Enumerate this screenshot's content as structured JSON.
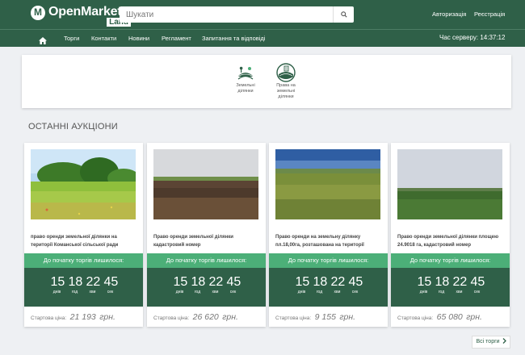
{
  "header": {
    "logo": {
      "brand": "OpenMarket",
      "sub": "Land"
    },
    "search": {
      "placeholder": "Шукати"
    },
    "login": "Авторизація",
    "register": "Реєстрація"
  },
  "nav": {
    "items": [
      "Торги",
      "Контакти",
      "Новини",
      "Регламент",
      "Запитання та відповіді"
    ],
    "server_time": "Час серверу: 14:37:12"
  },
  "categories": [
    {
      "label": "Земельні ділянки",
      "icon": "land-plots-icon"
    },
    {
      "label": "Права на земельні ділянки",
      "icon": "land-rights-icon"
    }
  ],
  "section_title": "ОСТАННІ АУКЦІОНИ",
  "auctions": [
    {
      "title": "право оренди земельної ділянки на території Команської сільської ради",
      "countdown_label": "До початку торгів лишилося:",
      "days": "15",
      "hours": "18",
      "minutes": "22",
      "seconds": "45",
      "days_lbl": "днів",
      "hours_lbl": "год",
      "minutes_lbl": "хви",
      "seconds_lbl": "сек",
      "price_label": "Стартова ціна:",
      "price": "21 193",
      "currency": "грн."
    },
    {
      "title": "Право оренди земельної ділянки кадастровий номер",
      "countdown_label": "До початку торгів лишилося:",
      "days": "15",
      "hours": "18",
      "minutes": "22",
      "seconds": "45",
      "days_lbl": "днів",
      "hours_lbl": "год",
      "minutes_lbl": "хви",
      "seconds_lbl": "сек",
      "price_label": "Стартова ціна:",
      "price": "26 620",
      "currency": "грн."
    },
    {
      "title": "Право оренди на земельну ділянку пл.18,00га, розташована на території",
      "countdown_label": "До початку торгів лишилося:",
      "days": "15",
      "hours": "18",
      "minutes": "22",
      "seconds": "45",
      "days_lbl": "днів",
      "hours_lbl": "год",
      "minutes_lbl": "хви",
      "seconds_lbl": "сек",
      "price_label": "Стартова ціна:",
      "price": "9 155",
      "currency": "грн."
    },
    {
      "title": "Право оренди земельної ділянки площею 24.9018 га, кадастровий номер",
      "countdown_label": "До початку торгів лишилося:",
      "days": "15",
      "hours": "18",
      "minutes": "22",
      "seconds": "45",
      "days_lbl": "днів",
      "hours_lbl": "год",
      "minutes_lbl": "хви",
      "seconds_lbl": "сек",
      "price_label": "Стартова ціна:",
      "price": "65 080",
      "currency": "грн."
    }
  ],
  "all_auctions_button": "Всі торги",
  "colors": {
    "brand_green": "#2f6048",
    "accent_green": "#4caf78"
  }
}
